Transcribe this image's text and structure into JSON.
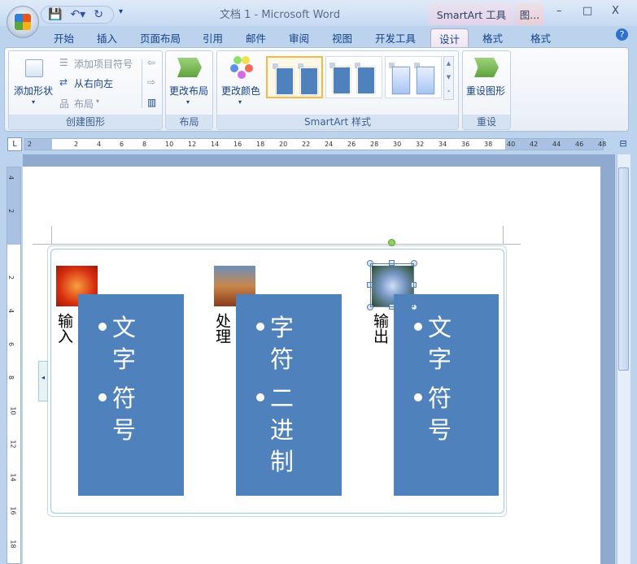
{
  "window": {
    "title": "文档 1 - Microsoft Word",
    "context_smartart": "SmartArt 工具",
    "context_picture": "图...",
    "minimize": "–",
    "maximize": "□",
    "close": "X"
  },
  "tabs": [
    "开始",
    "插入",
    "页面布局",
    "引用",
    "邮件",
    "审阅",
    "视图",
    "开发工具",
    "设计",
    "格式",
    "格式"
  ],
  "ribbon": {
    "create": {
      "add_shape": "添加形状",
      "add_bullet": "添加项目符号",
      "rtl": "从右向左",
      "layout": "布局",
      "label": "创建图形"
    },
    "layout": {
      "change_layout": "更改布局",
      "label": "布局"
    },
    "styles": {
      "change_colors": "更改颜色",
      "label": "SmartArt 样式"
    },
    "reset": {
      "reset_graphic": "重设图形",
      "label": "重设"
    }
  },
  "ruler": {
    "h": [
      "2",
      "2",
      "4",
      "6",
      "8",
      "10",
      "12",
      "14",
      "16",
      "18",
      "20",
      "22",
      "24",
      "26",
      "28",
      "30",
      "32",
      "34",
      "36",
      "38",
      "40",
      "42",
      "44",
      "46",
      "48"
    ],
    "v": [
      "4",
      "2",
      "",
      "2",
      "4",
      "6",
      "8",
      "10",
      "12",
      "14",
      "16",
      "18"
    ]
  },
  "smartart": {
    "columns": [
      {
        "label": "输入",
        "items": [
          "文字",
          "符号"
        ]
      },
      {
        "label": "处理",
        "items": [
          "字符",
          "二进制"
        ]
      },
      {
        "label": "输出",
        "items": [
          "文字",
          "符号"
        ]
      }
    ]
  },
  "colors": {
    "accent": "#4f81bd"
  }
}
